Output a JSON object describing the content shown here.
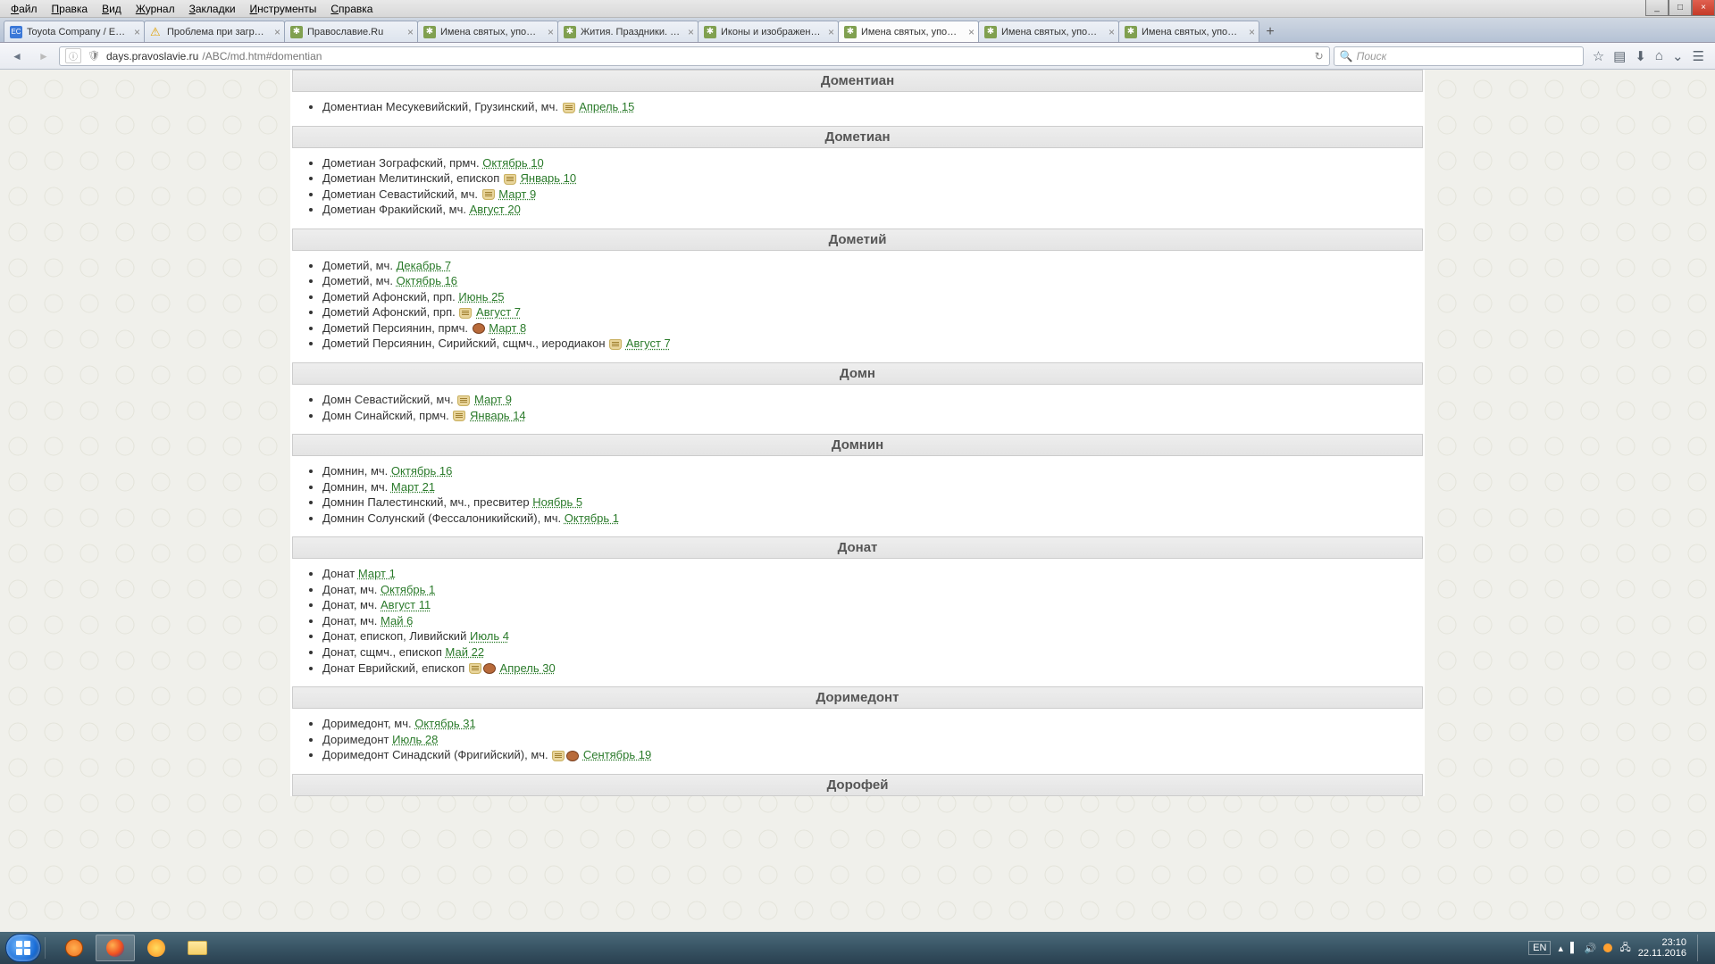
{
  "menu": [
    "Файл",
    "Правка",
    "Вид",
    "Журнал",
    "Закладки",
    "Инструменты",
    "Справка"
  ],
  "window_ctrl": {
    "min": "_",
    "max": "□",
    "close": "×"
  },
  "tabs": [
    {
      "title": "Toyota Company / Englis...",
      "fav": "#3b78d8",
      "active": false,
      "warn": false,
      "gear": false
    },
    {
      "title": "Проблема при загрузке ...",
      "fav": "#f0c040",
      "active": false,
      "warn": true,
      "gear": false
    },
    {
      "title": "Православие.Ru",
      "fav": "#80a050",
      "active": false,
      "warn": false,
      "gear": true
    },
    {
      "title": "Имена святых, упоминае...",
      "fav": "#80a050",
      "active": false,
      "warn": false,
      "gear": true
    },
    {
      "title": "Жития. Праздники. Икон...",
      "fav": "#80a050",
      "active": false,
      "warn": false,
      "gear": true
    },
    {
      "title": "Иконы и изображения п...",
      "fav": "#80a050",
      "active": false,
      "warn": false,
      "gear": true
    },
    {
      "title": "Имена святых, упоминае...",
      "fav": "#80a050",
      "active": true,
      "warn": false,
      "gear": true
    },
    {
      "title": "Имена святых, упоминае...",
      "fav": "#80a050",
      "active": false,
      "warn": false,
      "gear": true
    },
    {
      "title": "Имена святых, упоминае...",
      "fav": "#80a050",
      "active": false,
      "warn": false,
      "gear": true
    }
  ],
  "url": {
    "host": "days.pravoslavie.ru",
    "path": "/ABC/md.htm#domentian"
  },
  "search_placeholder": "Поиск",
  "sections": [
    {
      "title": "Доментиан",
      "entries": [
        {
          "text": "Доментиан Месукевийский, Грузинский, мч.",
          "icons": [
            "scroll"
          ],
          "date": "Апрель 15"
        }
      ]
    },
    {
      "title": "Дометиан",
      "entries": [
        {
          "text": "Дометиан Зографский, прмч.",
          "icons": [],
          "date": "Октябрь 10"
        },
        {
          "text": "Дометиан Мелитинский, епископ",
          "icons": [
            "scroll"
          ],
          "date": "Январь 10"
        },
        {
          "text": "Дометиан Севастийский, мч.",
          "icons": [
            "scroll"
          ],
          "date": "Март 9"
        },
        {
          "text": "Дометиан Фракийский, мч.",
          "icons": [],
          "date": "Август 20"
        }
      ]
    },
    {
      "title": "Дометий",
      "entries": [
        {
          "text": "Дометий, мч.",
          "icons": [],
          "date": "Декабрь 7"
        },
        {
          "text": "Дометий, мч.",
          "icons": [],
          "date": "Октябрь 16"
        },
        {
          "text": "Дометий Афонский, прп.",
          "icons": [],
          "date": "Июнь 25"
        },
        {
          "text": "Дометий Афонский, прп.",
          "icons": [
            "scroll"
          ],
          "date": "Август 7"
        },
        {
          "text": "Дометий Персиянин, прмч.",
          "icons": [
            "bread"
          ],
          "date": "Март 8"
        },
        {
          "text": "Дометий Персиянин, Сирийский, сщмч., иеродиакон",
          "icons": [
            "scroll"
          ],
          "date": "Август 7"
        }
      ]
    },
    {
      "title": "Домн",
      "entries": [
        {
          "text": "Домн Севастийский, мч.",
          "icons": [
            "scroll"
          ],
          "date": "Март 9"
        },
        {
          "text": "Домн Синайский, прмч.",
          "icons": [
            "scroll"
          ],
          "date": "Январь 14"
        }
      ]
    },
    {
      "title": "Домнин",
      "entries": [
        {
          "text": "Домнин, мч.",
          "icons": [],
          "date": "Октябрь 16"
        },
        {
          "text": "Домнин, мч.",
          "icons": [],
          "date": "Март 21"
        },
        {
          "text": "Домнин Палестинский, мч., пресвитер",
          "icons": [],
          "date": "Ноябрь 5"
        },
        {
          "text": "Домнин Солунский (Фессалоникийский), мч.",
          "icons": [],
          "date": "Октябрь 1"
        }
      ]
    },
    {
      "title": "Донат",
      "entries": [
        {
          "text": "Донат",
          "icons": [],
          "date": "Март 1"
        },
        {
          "text": "Донат, мч.",
          "icons": [],
          "date": "Октябрь 1"
        },
        {
          "text": "Донат, мч.",
          "icons": [],
          "date": "Август 11"
        },
        {
          "text": "Донат, мч.",
          "icons": [],
          "date": "Май 6"
        },
        {
          "text": "Донат, епископ, Ливийский",
          "icons": [],
          "date": "Июль 4"
        },
        {
          "text": "Донат, сщмч., епископ",
          "icons": [],
          "date": "Май 22"
        },
        {
          "text": "Донат Еврийский, епископ",
          "icons": [
            "scroll",
            "bread"
          ],
          "date": "Апрель 30"
        }
      ]
    },
    {
      "title": "Доримедонт",
      "entries": [
        {
          "text": "Доримедонт, мч.",
          "icons": [],
          "date": "Октябрь 31"
        },
        {
          "text": "Доримедонт",
          "icons": [],
          "date": "Июль 28"
        },
        {
          "text": "Доримедонт Синадский (Фригийский), мч.",
          "icons": [
            "scroll",
            "bread"
          ],
          "date": "Сентябрь 19"
        }
      ]
    },
    {
      "title": "Дорофей",
      "entries": []
    }
  ],
  "tray": {
    "lang": "EN",
    "time": "23:10",
    "date": "22.11.2016"
  }
}
